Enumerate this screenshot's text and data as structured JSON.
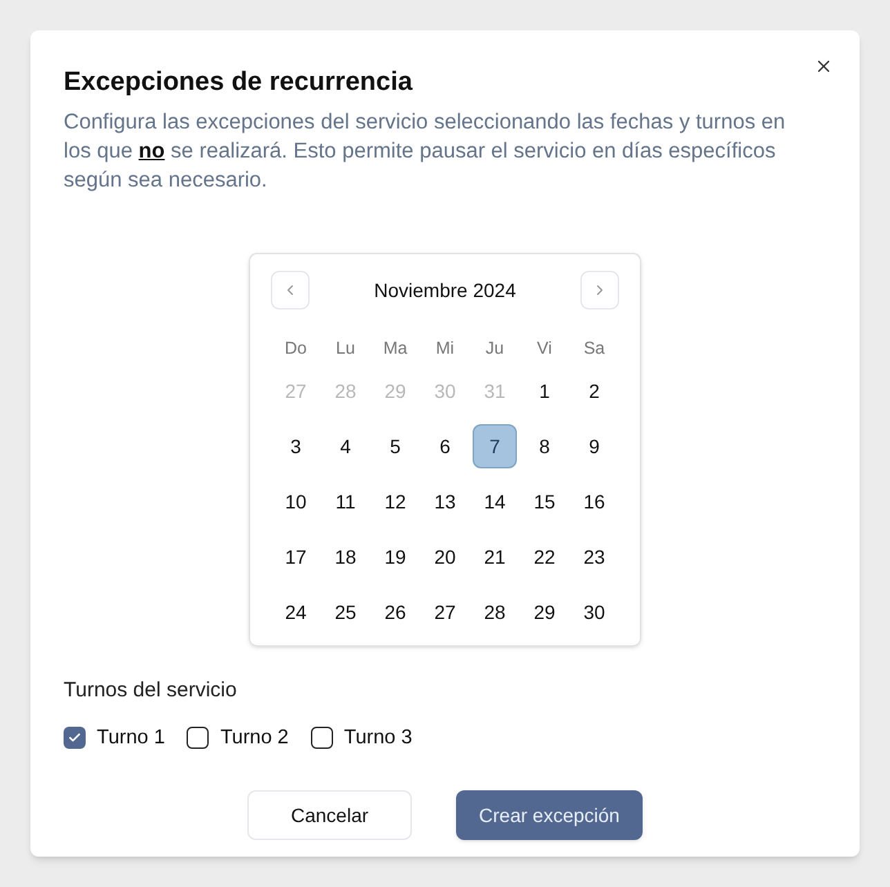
{
  "dialog": {
    "title": "Excepciones de recurrencia",
    "description": "Configura las excepciones del servicio seleccionando las fechas y turnos en los que **no** se realizará. Esto permite pausar el servicio en días específicos según sea necesario."
  },
  "calendar": {
    "month": "Noviembre 2024",
    "weekdays": [
      "Do",
      "Lu",
      "Ma",
      "Mi",
      "Ju",
      "Vi",
      "Sa"
    ],
    "days": [
      {
        "label": "27",
        "outside": true,
        "selected": false
      },
      {
        "label": "28",
        "outside": true,
        "selected": false
      },
      {
        "label": "29",
        "outside": true,
        "selected": false
      },
      {
        "label": "30",
        "outside": true,
        "selected": false
      },
      {
        "label": "31",
        "outside": true,
        "selected": false
      },
      {
        "label": "1",
        "outside": false,
        "selected": false
      },
      {
        "label": "2",
        "outside": false,
        "selected": false
      },
      {
        "label": "3",
        "outside": false,
        "selected": false
      },
      {
        "label": "4",
        "outside": false,
        "selected": false
      },
      {
        "label": "5",
        "outside": false,
        "selected": false
      },
      {
        "label": "6",
        "outside": false,
        "selected": false
      },
      {
        "label": "7",
        "outside": false,
        "selected": true
      },
      {
        "label": "8",
        "outside": false,
        "selected": false
      },
      {
        "label": "9",
        "outside": false,
        "selected": false
      },
      {
        "label": "10",
        "outside": false,
        "selected": false
      },
      {
        "label": "11",
        "outside": false,
        "selected": false
      },
      {
        "label": "12",
        "outside": false,
        "selected": false
      },
      {
        "label": "13",
        "outside": false,
        "selected": false
      },
      {
        "label": "14",
        "outside": false,
        "selected": false
      },
      {
        "label": "15",
        "outside": false,
        "selected": false
      },
      {
        "label": "16",
        "outside": false,
        "selected": false
      },
      {
        "label": "17",
        "outside": false,
        "selected": false
      },
      {
        "label": "18",
        "outside": false,
        "selected": false
      },
      {
        "label": "19",
        "outside": false,
        "selected": false
      },
      {
        "label": "20",
        "outside": false,
        "selected": false
      },
      {
        "label": "21",
        "outside": false,
        "selected": false
      },
      {
        "label": "22",
        "outside": false,
        "selected": false
      },
      {
        "label": "23",
        "outside": false,
        "selected": false
      },
      {
        "label": "24",
        "outside": false,
        "selected": false
      },
      {
        "label": "25",
        "outside": false,
        "selected": false
      },
      {
        "label": "26",
        "outside": false,
        "selected": false
      },
      {
        "label": "27",
        "outside": false,
        "selected": false
      },
      {
        "label": "28",
        "outside": false,
        "selected": false
      },
      {
        "label": "29",
        "outside": false,
        "selected": false
      },
      {
        "label": "30",
        "outside": false,
        "selected": false
      }
    ]
  },
  "shifts": {
    "label": "Turnos del servicio",
    "options": [
      {
        "label": "Turno 1",
        "checked": true
      },
      {
        "label": "Turno 2",
        "checked": false
      },
      {
        "label": "Turno 3",
        "checked": false
      }
    ]
  },
  "buttons": {
    "cancel": "Cancelar",
    "submit": "Crear excepción"
  }
}
